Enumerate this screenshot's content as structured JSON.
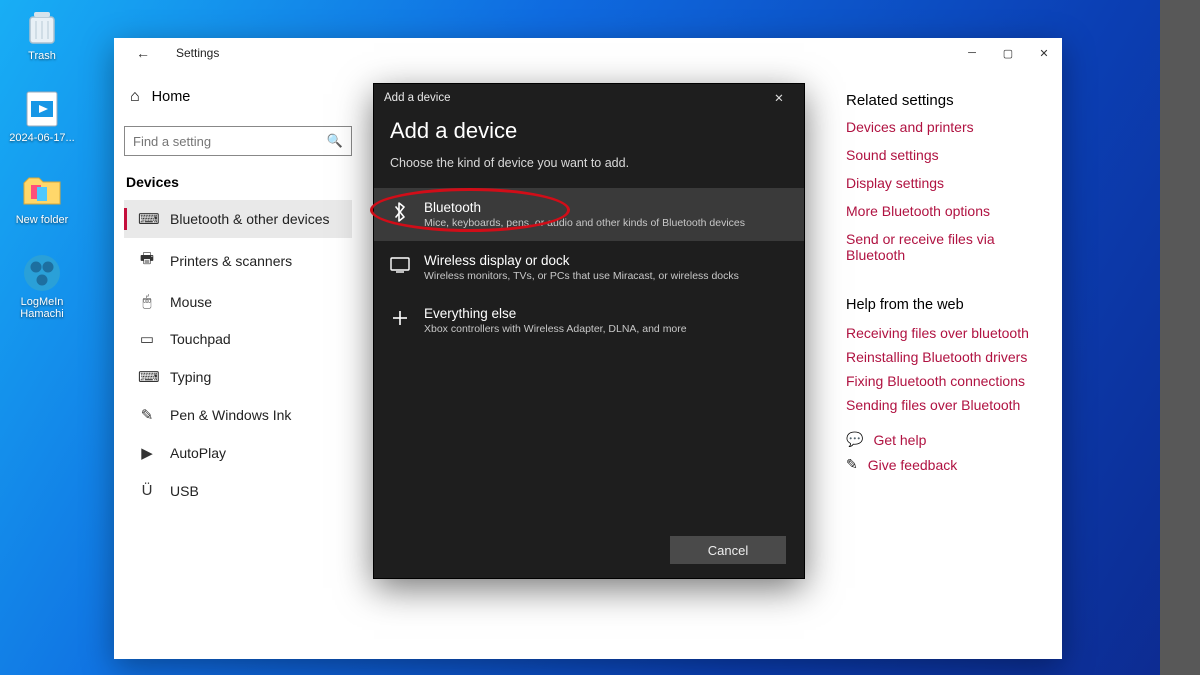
{
  "desktop_icons": [
    {
      "name": "Trash"
    },
    {
      "name": "2024-06-17..."
    },
    {
      "name": "New folder"
    },
    {
      "name": "LogMeIn Hamachi"
    }
  ],
  "window": {
    "title": "Settings",
    "back_label": "←"
  },
  "sidebar": {
    "home": "Home",
    "search_placeholder": "Find a setting",
    "header": "Devices",
    "items": [
      {
        "icon": "bluetooth",
        "label": "Bluetooth & other devices",
        "active": true
      },
      {
        "icon": "printer",
        "label": "Printers & scanners"
      },
      {
        "icon": "mouse",
        "label": "Mouse"
      },
      {
        "icon": "touchpad",
        "label": "Touchpad"
      },
      {
        "icon": "typing",
        "label": "Typing"
      },
      {
        "icon": "pen",
        "label": "Pen & Windows Ink"
      },
      {
        "icon": "autoplay",
        "label": "AutoPlay"
      },
      {
        "icon": "usb",
        "label": "USB"
      }
    ]
  },
  "right": {
    "related_heading": "Related settings",
    "related": [
      "Devices and printers",
      "Sound settings",
      "Display settings",
      "More Bluetooth options",
      "Send or receive files via Bluetooth"
    ],
    "help_heading": "Help from the web",
    "help": [
      "Receiving files over bluetooth",
      "Reinstalling Bluetooth drivers",
      "Fixing Bluetooth connections",
      "Sending files over Bluetooth"
    ],
    "get_help": "Get help",
    "give_feedback": "Give feedback"
  },
  "dialog": {
    "titlebar": "Add a device",
    "heading": "Add a device",
    "subheading": "Choose the kind of device you want to add.",
    "options": [
      {
        "icon": "bluetooth",
        "title": "Bluetooth",
        "desc": "Mice, keyboards, pens, or audio and other kinds of Bluetooth devices"
      },
      {
        "icon": "display",
        "title": "Wireless display or dock",
        "desc": "Wireless monitors, TVs, or PCs that use Miracast, or wireless docks"
      },
      {
        "icon": "plus",
        "title": "Everything else",
        "desc": "Xbox controllers with Wireless Adapter, DLNA, and more"
      }
    ],
    "cancel": "Cancel"
  }
}
